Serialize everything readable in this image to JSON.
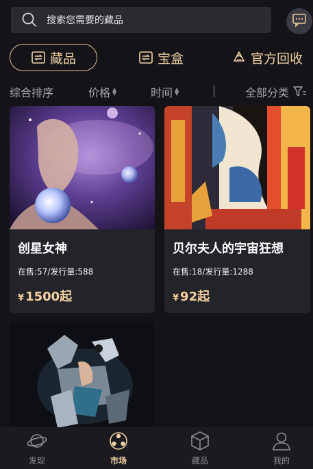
{
  "search": {
    "placeholder": "搜索您需要的藏品"
  },
  "tabs": [
    {
      "label": "藏品",
      "icon": "swap-card-icon",
      "active": true
    },
    {
      "label": "宝盒",
      "icon": "swap-card-icon",
      "active": false
    },
    {
      "label": "官方回收",
      "icon": "recycle-icon",
      "active": false
    }
  ],
  "filters": {
    "sort": "综合排序",
    "price": "价格",
    "time": "时间",
    "category": "全部分类"
  },
  "products": [
    {
      "name": "创星女神",
      "stats": "在售:57/发行量:588",
      "currency": "¥",
      "price": "1500起"
    },
    {
      "name": "贝尔夫人的宇宙狂想",
      "stats": "在售:18/发行量:1288",
      "currency": "¥",
      "price": "92起"
    },
    {
      "name": ""
    }
  ],
  "nav": [
    {
      "label": "发现",
      "icon": "planet-icon"
    },
    {
      "label": "市场",
      "icon": "market-icon",
      "active": true
    },
    {
      "label": "藏品",
      "icon": "cube-icon"
    },
    {
      "label": "我的",
      "icon": "user-icon"
    }
  ],
  "colors": {
    "background": "#131318",
    "card": "#23232a",
    "accent": "#f2d2a6",
    "muted": "#8e8e96"
  }
}
